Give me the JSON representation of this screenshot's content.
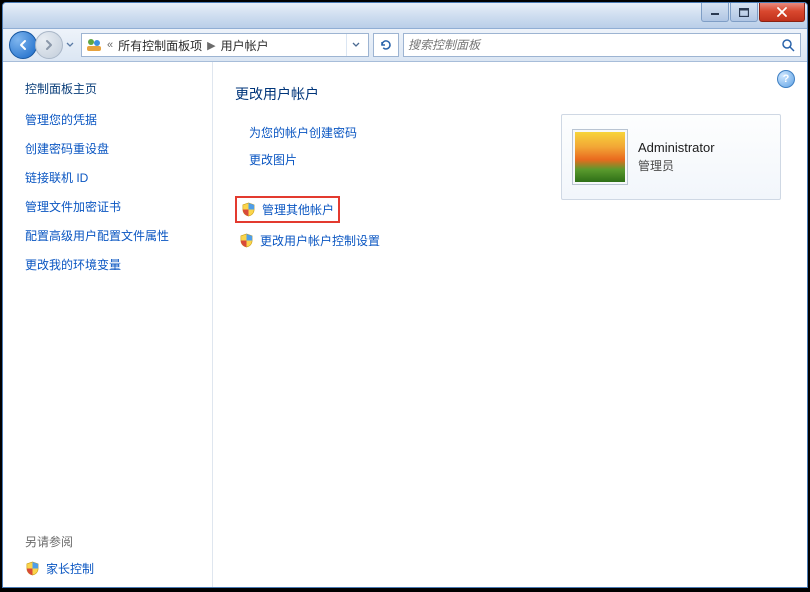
{
  "titlebar": {},
  "nav": {
    "breadcrumb_prefix": "«",
    "breadcrumb_1": "所有控制面板项",
    "breadcrumb_sep": "▶",
    "breadcrumb_2": "用户帐户"
  },
  "search": {
    "placeholder": "搜索控制面板"
  },
  "sidebar": {
    "home": "控制面板主页",
    "links": [
      "管理您的凭据",
      "创建密码重设盘",
      "链接联机 ID",
      "管理文件加密证书",
      "配置高级用户配置文件属性",
      "更改我的环境变量"
    ],
    "see_also": "另请参阅",
    "parental": "家长控制"
  },
  "main": {
    "title": "更改用户帐户",
    "actions_primary": [
      "为您的帐户创建密码",
      "更改图片"
    ],
    "action_manage_other": "管理其他帐户",
    "action_uac": "更改用户帐户控制设置"
  },
  "user": {
    "name": "Administrator",
    "role": "管理员"
  },
  "help": "?"
}
